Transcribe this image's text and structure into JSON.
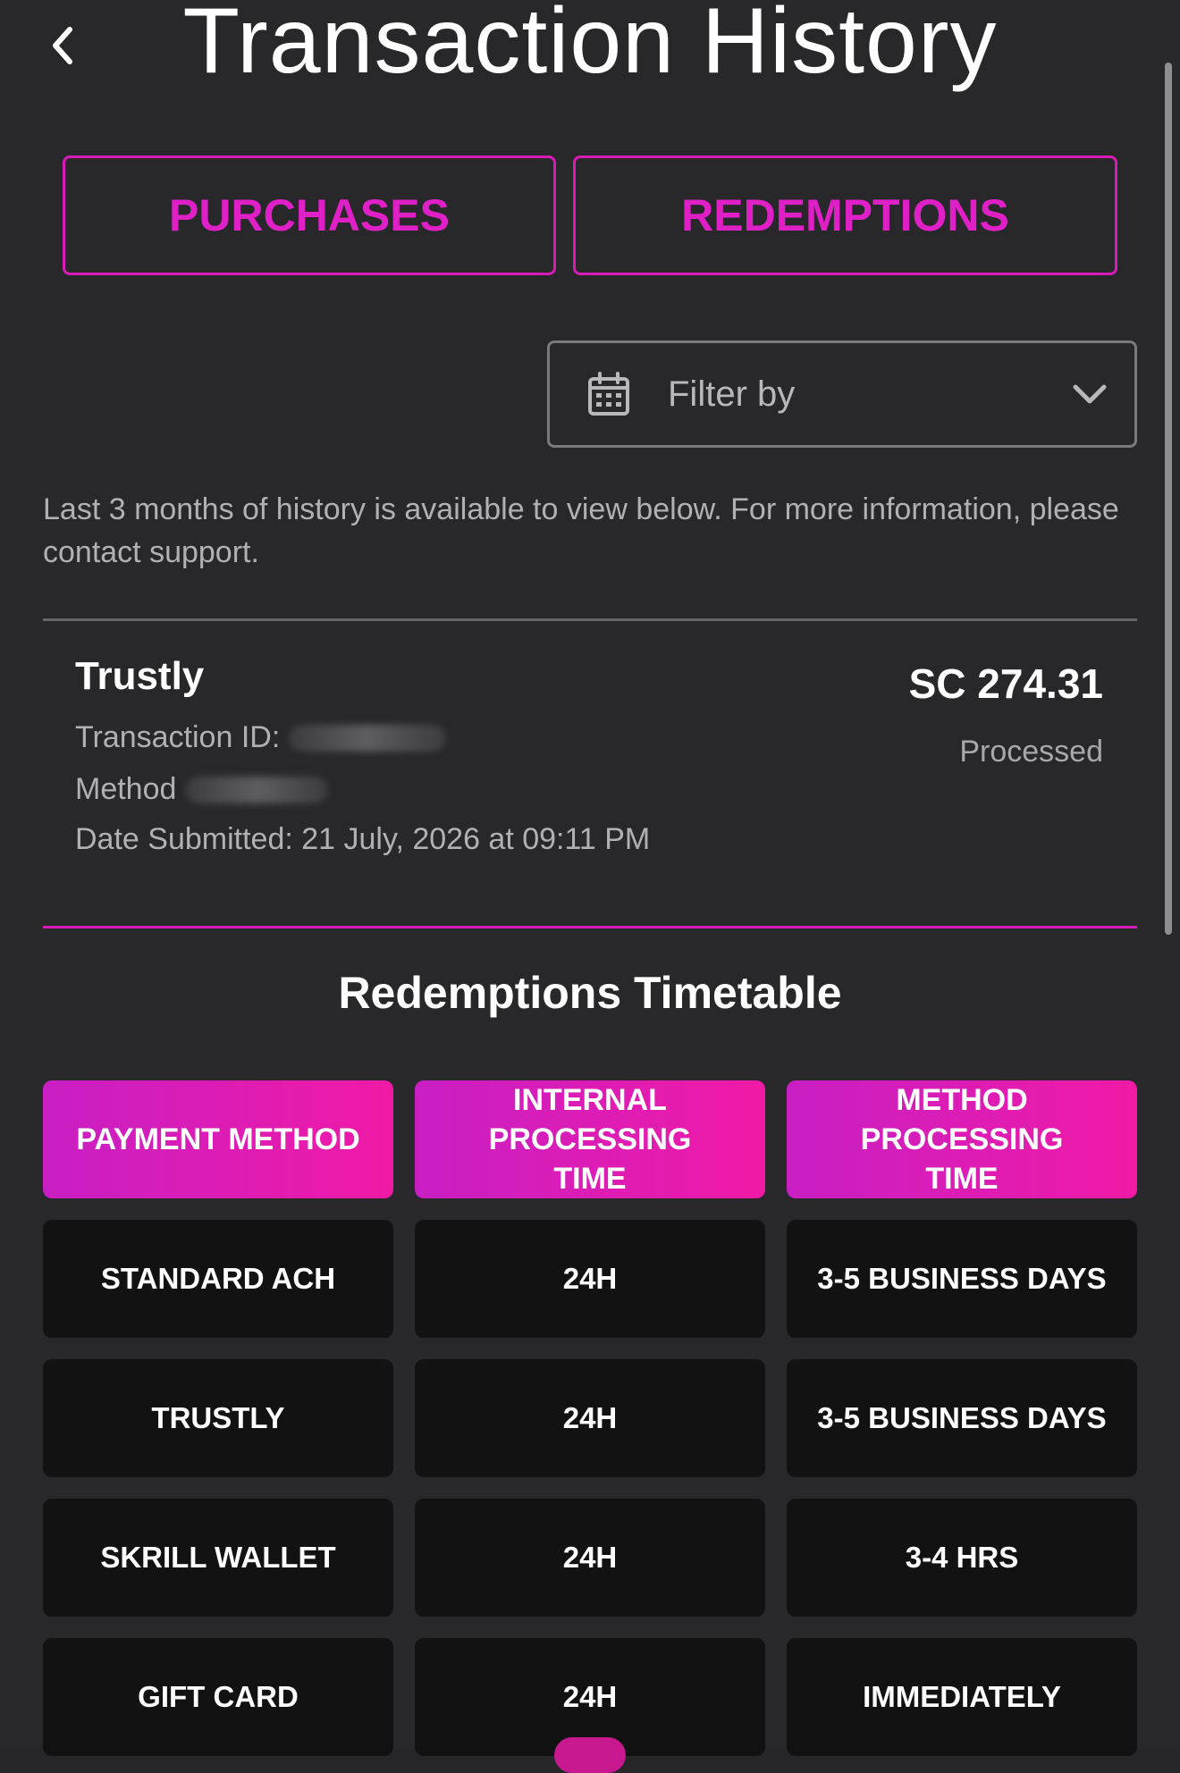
{
  "header": {
    "title": "Transaction History",
    "back_icon": "chevron-left-icon"
  },
  "tabs": [
    {
      "label": "PURCHASES"
    },
    {
      "label": "REDEMPTIONS"
    }
  ],
  "filter": {
    "label": "Filter by",
    "icon": "calendar-icon",
    "dropdown_icon": "chevron-down-icon"
  },
  "info_text": "Last 3 months of history is available to view below. For more information, please contact support.",
  "transaction": {
    "name": "Trustly",
    "amount": "SC 274.31",
    "status": "Processed",
    "id_label": "Transaction ID:",
    "method_label": "Method",
    "date_submitted": "Date Submitted: 21 July, 2026 at 09:11 PM"
  },
  "timetable": {
    "title": "Redemptions Timetable",
    "headers": [
      "PAYMENT METHOD",
      "INTERNAL PROCESSING TIME",
      "METHOD PROCESSING TIME"
    ],
    "rows": [
      [
        "STANDARD ACH",
        "24H",
        "3-5 BUSINESS DAYS"
      ],
      [
        "TRUSTLY",
        "24H",
        "3-5 BUSINESS DAYS"
      ],
      [
        "SKRILL WALLET",
        "24H",
        "3-4 HRS"
      ],
      [
        "GIFT CARD",
        "24H",
        "IMMEDIATELY"
      ]
    ]
  },
  "colors": {
    "accent": "#e020c7",
    "gradient_start": "#c81fc4",
    "gradient_end": "#f01aa6",
    "background": "#28282b",
    "cell_background": "#121213"
  }
}
